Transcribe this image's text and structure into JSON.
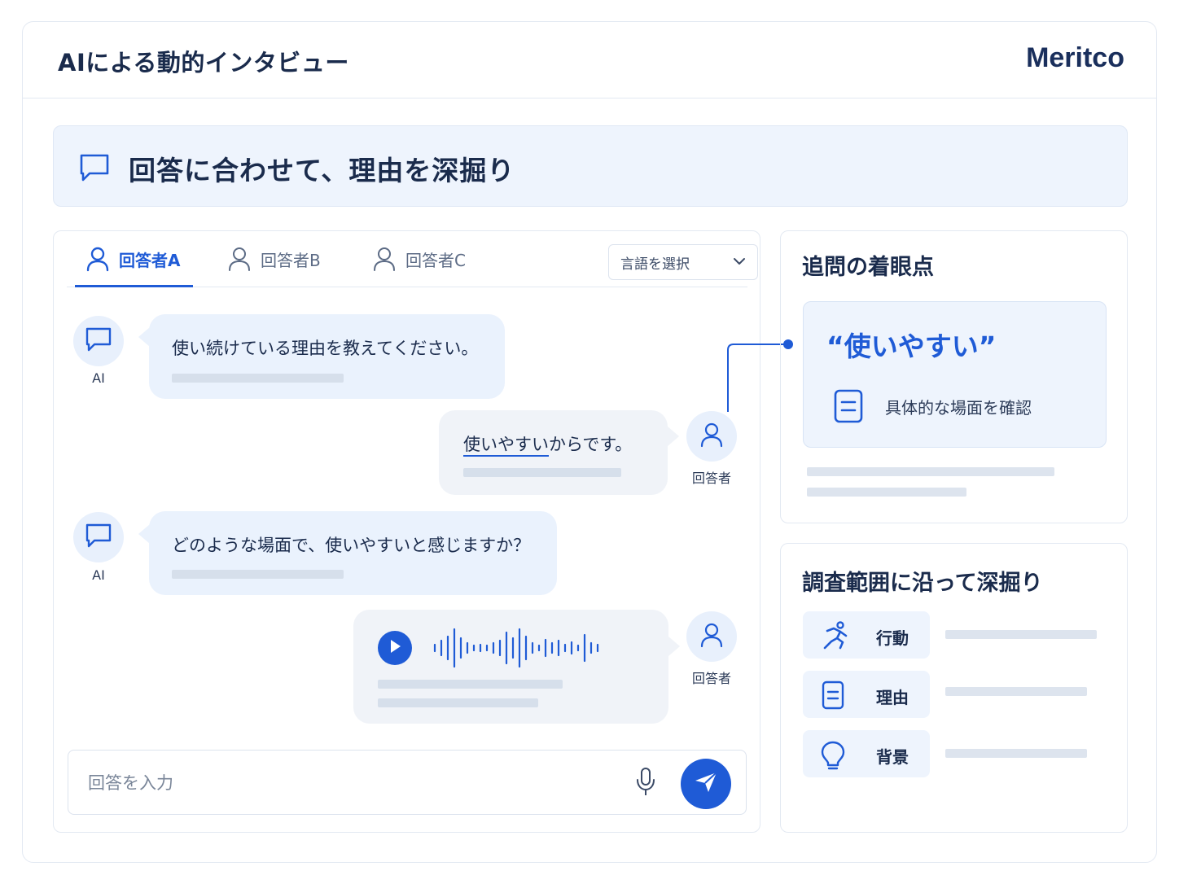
{
  "header": {
    "title": "AIによる動的インタビュー",
    "brand": "Meritco"
  },
  "banner": {
    "text": "回答に合わせて、理由を深掘り"
  },
  "tabs": [
    {
      "label": "回答者A",
      "active": true
    },
    {
      "label": "回答者B",
      "active": false
    },
    {
      "label": "回答者C",
      "active": false
    }
  ],
  "language_select": {
    "value": "言語を選択"
  },
  "messages": [
    {
      "sender": "AI",
      "text": "使い続けている理由を教えてください。"
    },
    {
      "sender": "回答者",
      "text_highlight": "使いやすい",
      "text_rest": "からです。"
    },
    {
      "sender": "AI",
      "text": "どのような場面で、使いやすいと感じますか？"
    },
    {
      "sender": "回答者",
      "type": "audio"
    }
  ],
  "input": {
    "placeholder": "回答を入力"
  },
  "focus_panel": {
    "heading": "追問の着眼点",
    "keyword": "“使いやすい”",
    "action": "具体的な場面を確認"
  },
  "scope_panel": {
    "heading": "調査範囲に沿って深掘り",
    "items": [
      {
        "label": "行動",
        "icon": "running-person-icon"
      },
      {
        "label": "理由",
        "icon": "document-icon"
      },
      {
        "label": "背景",
        "icon": "lightbulb-icon"
      }
    ]
  },
  "colors": {
    "accent": "#1f5bd6",
    "bubble_ai": "#eaf2fd",
    "bubble_user": "#f0f3f8"
  }
}
